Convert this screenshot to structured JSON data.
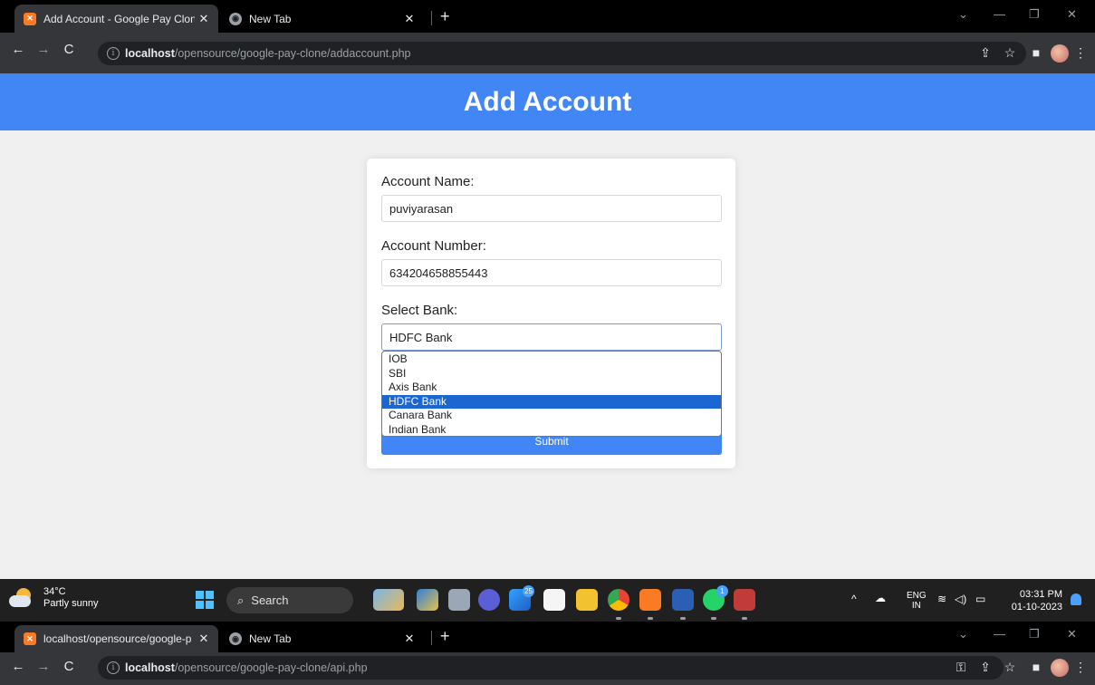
{
  "browser1": {
    "tabs": [
      {
        "title": "Add Account - Google Pay Clon",
        "close": "✕"
      },
      {
        "title": "New Tab",
        "close": "✕"
      }
    ],
    "new_tab": "+",
    "url_host": "localhost",
    "url_path": "/opensource/google-pay-clone/addaccount.php"
  },
  "page": {
    "header_title": "Add Account",
    "form": {
      "account_name_label": "Account Name:",
      "account_name_value": "puviyarasan",
      "account_number_label": "Account Number:",
      "account_number_value": "634204658855443",
      "bank_label": "Select Bank:",
      "bank_selected": "HDFC Bank",
      "bank_options": [
        "IOB",
        "SBI",
        "Axis Bank",
        "HDFC Bank",
        "Canara Bank",
        "Indian Bank"
      ],
      "submit_label": "Submit"
    }
  },
  "taskbar": {
    "weather_temp": "34°C",
    "weather_desc": "Partly sunny",
    "search_label": "Search",
    "mail_badge": "25",
    "whatsapp_badge": "1",
    "lang_line1": "ENG",
    "lang_line2": "IN",
    "time": "03:31 PM",
    "date": "01-10-2023"
  },
  "browser2": {
    "tabs": [
      {
        "title": "localhost/opensource/google-p",
        "close": "✕"
      },
      {
        "title": "New Tab",
        "close": "✕"
      }
    ],
    "new_tab": "+",
    "url_host": "localhost",
    "url_path": "/opensource/google-pay-clone/api.php"
  },
  "colors": {
    "header_blue": "#4285f4",
    "selected_option": "#1a66d2",
    "page_bg": "#f0f0f0",
    "taskbar_bg": "#202020"
  }
}
